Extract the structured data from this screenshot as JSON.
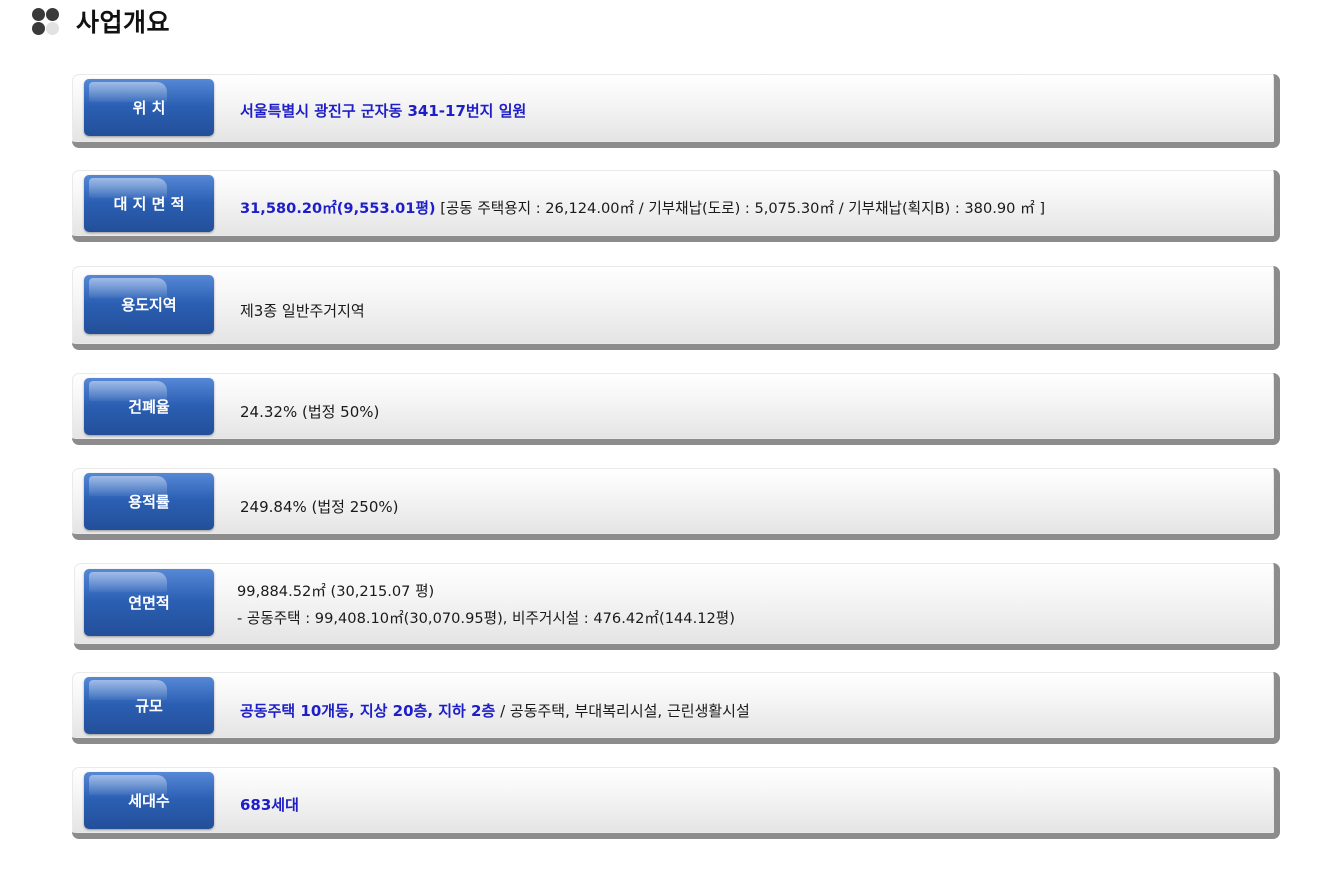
{
  "header": {
    "title": "사업개요"
  },
  "rows": [
    {
      "label": "위 치",
      "value_blue": "서울특별시 광진구 군자동 341-17번지 일원"
    },
    {
      "label": "대 지 면 적",
      "value_blue": "31,580.20㎡(9,553.01평)",
      "value_rest": "[공동 주택용지 : 26,124.00㎡ / 기부채납(도로) : 5,075.30㎡ / 기부채납(획지B) : 380.90 ㎡ ]"
    },
    {
      "label": "용도지역",
      "value": "제3종 일반주거지역"
    },
    {
      "label": "건폐율",
      "value": "24.32% (법정 50%)"
    },
    {
      "label": "용적률",
      "value": "249.84% (법정 250%)"
    },
    {
      "label": "연면적",
      "line1": "99,884.52㎡ (30,215.07 평)",
      "line2": "-   공동주택 : 99,408.10㎡(30,070.95평), 비주거시설 : 476.42㎡(144.12평)"
    },
    {
      "label": "규모",
      "value_blue": "공동주택 10개동, 지상 20층, 지하 2층",
      "value_rest": "/ 공동주택, 부대복리시설, 근린생활시설"
    },
    {
      "label": "세대수",
      "value_blue": "683세대"
    }
  ]
}
